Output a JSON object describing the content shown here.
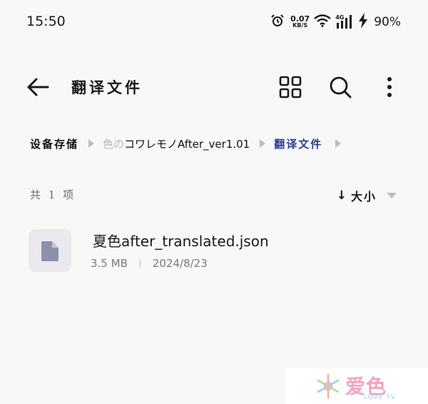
{
  "status_bar": {
    "time": "15:50",
    "net_speed_value": "0.07",
    "net_speed_unit": "KB/S",
    "network_type": "4G",
    "battery": "90%"
  },
  "toolbar": {
    "title": "翻译文件",
    "icons": [
      "back-arrow-icon",
      "grid-view-icon",
      "search-icon",
      "more-vertical-icon"
    ]
  },
  "breadcrumb": {
    "root": "设备存储",
    "folder_faded": "色の",
    "folder_rest": "コワレモノAfter_ver1.01",
    "current": "翻译文件"
  },
  "list_header": {
    "count": "共 1 项",
    "sort_arrow": "↓",
    "sort_label": "大小"
  },
  "files": [
    {
      "name": "夏色after_translated.json",
      "size": "3.5 MB",
      "date": "2024/8/23"
    }
  ],
  "watermark": {
    "text": "爱色",
    "sub": "LOVE TV"
  },
  "colors": {
    "background": "#f8f8f8",
    "accent": "#2f3a98",
    "thumb_bg": "#e9e9ee",
    "file_icon": "#8e8fa9"
  }
}
